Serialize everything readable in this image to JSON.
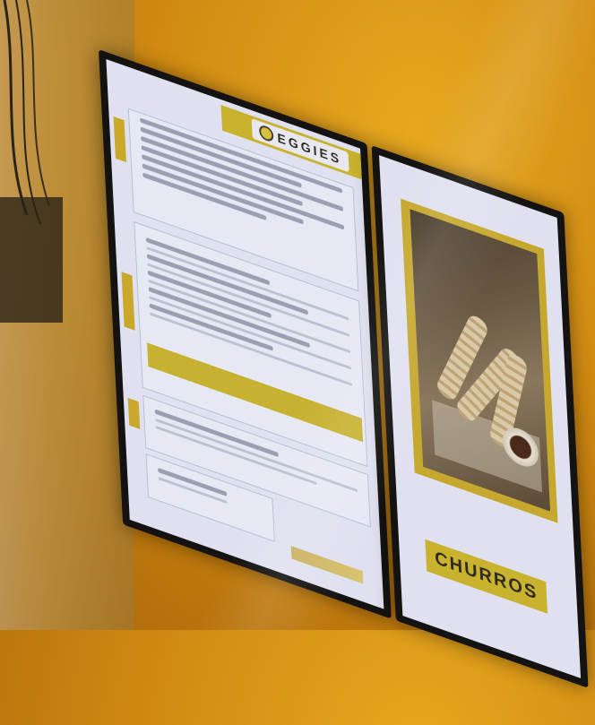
{
  "brand": {
    "name": "EGGIES",
    "logo_icon": "egg-logo-icon"
  },
  "menu_board": {
    "sections": [
      {
        "name": "section-1",
        "items": 7
      },
      {
        "name": "section-2",
        "items": 6
      },
      {
        "name": "section-3",
        "items": 2
      },
      {
        "name": "section-4",
        "items": 1
      }
    ]
  },
  "promo": {
    "product": "CHURROS",
    "image": "churros-photo"
  },
  "colors": {
    "accent_yellow": "#c9b22e",
    "screen_bg": "#dfe1f0",
    "wall": "#d08a12",
    "bezel": "#141312"
  }
}
